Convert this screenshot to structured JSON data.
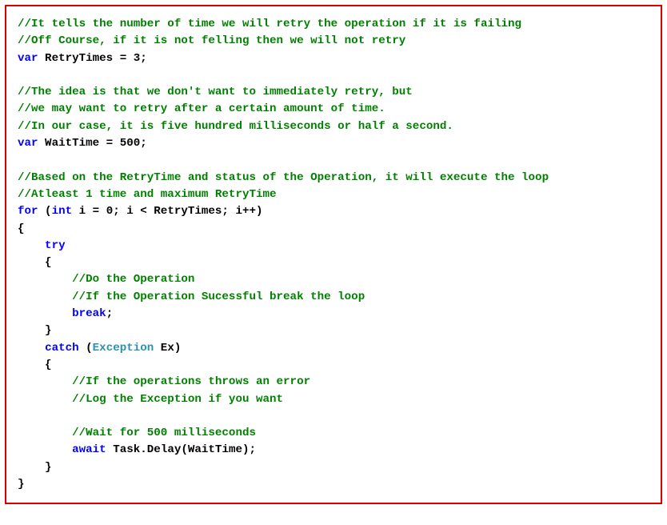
{
  "code": {
    "c1": "//It tells the number of time we will retry the operation if it is failing",
    "c2": "//Off Course, if it is not felling then we will not retry",
    "kw_var1": "var",
    "var1_name": " RetryTimes = 3;",
    "c3": "//The idea is that we don't want to immediately retry, but",
    "c4": "//we may want to retry after a certain amount of time.",
    "c5": "//In our case, it is five hundred milliseconds or half a second.",
    "kw_var2": "var",
    "var2_name": " WaitTime = 500;",
    "c6": "//Based on the RetryTime and status of the Operation, it will execute the loop",
    "c7": "//Atleast 1 time and maximum RetryTime",
    "kw_for": "for",
    "for_open": " (",
    "kw_int": "int",
    "for_cond": " i = 0; i < RetryTimes; i++)",
    "brace_open1": "{",
    "kw_try": "    try",
    "brace_open2": "    {",
    "c8": "        //Do the Operation",
    "c9": "        //If the Operation Sucessful break the loop",
    "indent_break": "        ",
    "kw_break": "break",
    "semi1": ";",
    "brace_close2": "    }",
    "indent_catch": "    ",
    "kw_catch": "catch",
    "catch_open": " (",
    "type_exception": "Exception",
    "catch_var": " Ex)",
    "brace_open3": "    {",
    "c10": "        //If the operations throws an error",
    "c11": "        //Log the Exception if you want",
    "c12": "        //Wait for 500 milliseconds",
    "indent_await": "        ",
    "kw_await": "await",
    "await_call": " Task.Delay(WaitTime);",
    "brace_close3": "    }",
    "brace_close1": "}"
  }
}
